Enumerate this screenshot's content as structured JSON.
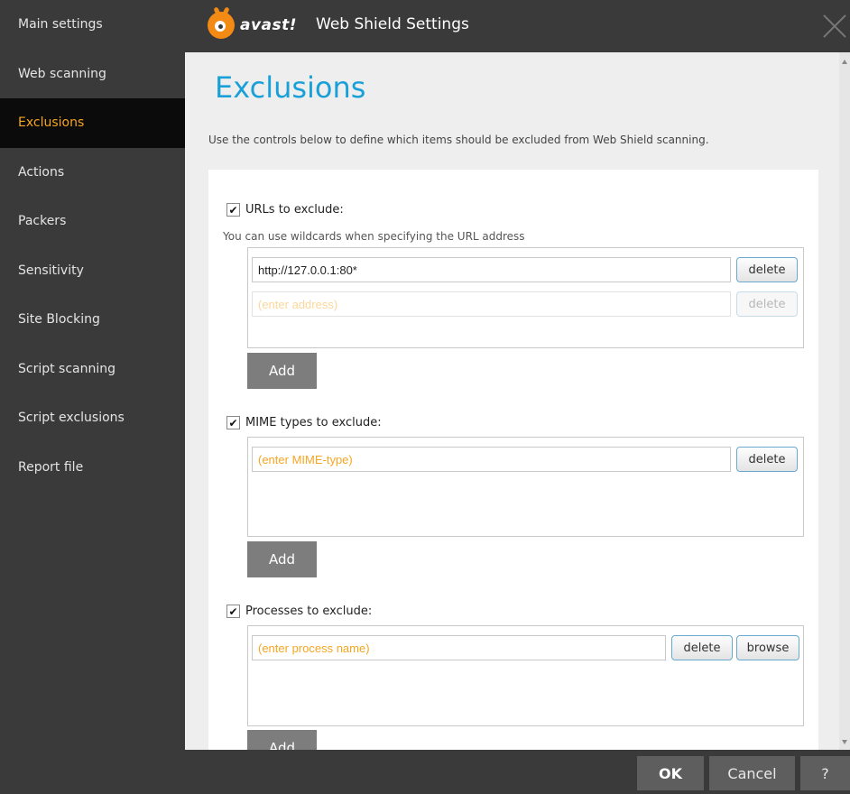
{
  "window": {
    "logo_text": "avast!",
    "title": "Web Shield Settings"
  },
  "sidebar": {
    "items": [
      {
        "label": "Main settings"
      },
      {
        "label": "Web scanning"
      },
      {
        "label": "Exclusions"
      },
      {
        "label": "Actions"
      },
      {
        "label": "Packers"
      },
      {
        "label": "Sensitivity"
      },
      {
        "label": "Site Blocking"
      },
      {
        "label": "Script scanning"
      },
      {
        "label": "Script exclusions"
      },
      {
        "label": "Report file"
      }
    ],
    "active": "Exclusions"
  },
  "main": {
    "title": "Exclusions",
    "intro": "Use the controls below to define which items should be excluded from Web Shield scanning."
  },
  "urls": {
    "label": "URLs to exclude:",
    "checked": true,
    "hint": "You can use wildcards when specifying the URL address",
    "entry_value": "http://127.0.0.1:80*",
    "delete_label": "delete",
    "placeholder": "(enter address)",
    "add_label": "Add"
  },
  "mime": {
    "label": "MIME types to exclude:",
    "checked": true,
    "placeholder": "(enter MIME-type)",
    "delete_label": "delete",
    "add_label": "Add"
  },
  "processes": {
    "label": "Processes to exclude:",
    "checked": true,
    "placeholder": "(enter process name)",
    "delete_label": "delete",
    "browse_label": "browse",
    "add_label": "Add"
  },
  "footer": {
    "ok_label": "OK",
    "cancel_label": "Cancel",
    "help_label": "?"
  },
  "check_glyph": "✔",
  "colors": {
    "accent_orange": "#f5a623",
    "title_blue": "#1aa0d8",
    "sidebar_bg": "#3a3a3a",
    "sidebar_active_bg": "#0b0b0b"
  }
}
